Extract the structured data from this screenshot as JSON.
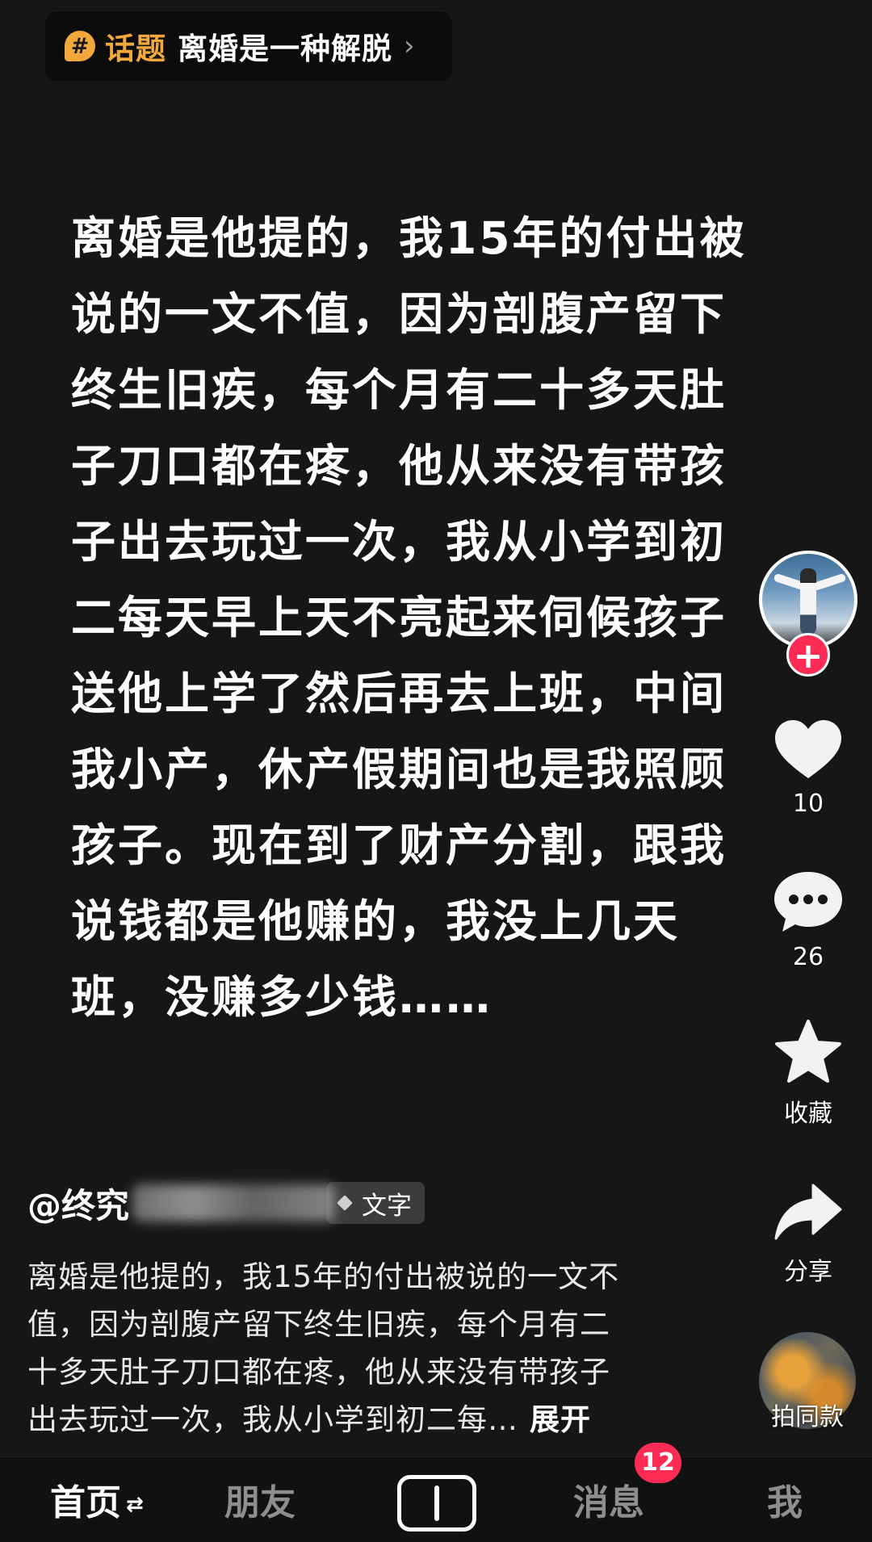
{
  "topic": {
    "icon": "hashtag-icon",
    "label": "话题",
    "name": "离婚是一种解脱",
    "chevron": "›"
  },
  "main_text_lines": [
    "离婚是他提的，我15年的付出被",
    "说的一文不值，因为剖腹产留下",
    "终生旧疾，每个月有二十多天肚",
    "子刀口都在疼，他从来没有带孩",
    "子出去玩过一次，我从小学到初",
    "二每天早上天不亮起来伺候孩子",
    "送他上学了然后再去上班，中间",
    "我小产，休产假期间也是我照顾",
    "孩子。现在到了财产分割，跟我",
    "说钱都是他赚的，我没上几天",
    "班，没赚多少钱……"
  ],
  "rail": {
    "follow": "+",
    "like_count": "10",
    "comment_count": "26",
    "favorite_label": "收藏",
    "share_label": "分享",
    "same_label": "拍同款"
  },
  "author": {
    "name_visible": "@终究",
    "tag_label": "文字"
  },
  "caption": {
    "lines": [
      "离婚是他提的，我15年的付出被说的一文不",
      "值，因为剖腹产留下终生旧疾，每个月有二",
      "十多天肚子刀口都在疼，他从来没有带孩子",
      "出去玩过一次，我从小学到初二每…"
    ],
    "expand": "展开"
  },
  "nav": {
    "home": "首页",
    "home_swap": "⇄",
    "friends": "朋友",
    "messages": "消息",
    "messages_badge": "12",
    "me": "我"
  },
  "colors": {
    "accent_topic": "#f2a83b",
    "badge_red": "#fe2c55",
    "background": "#161616"
  }
}
